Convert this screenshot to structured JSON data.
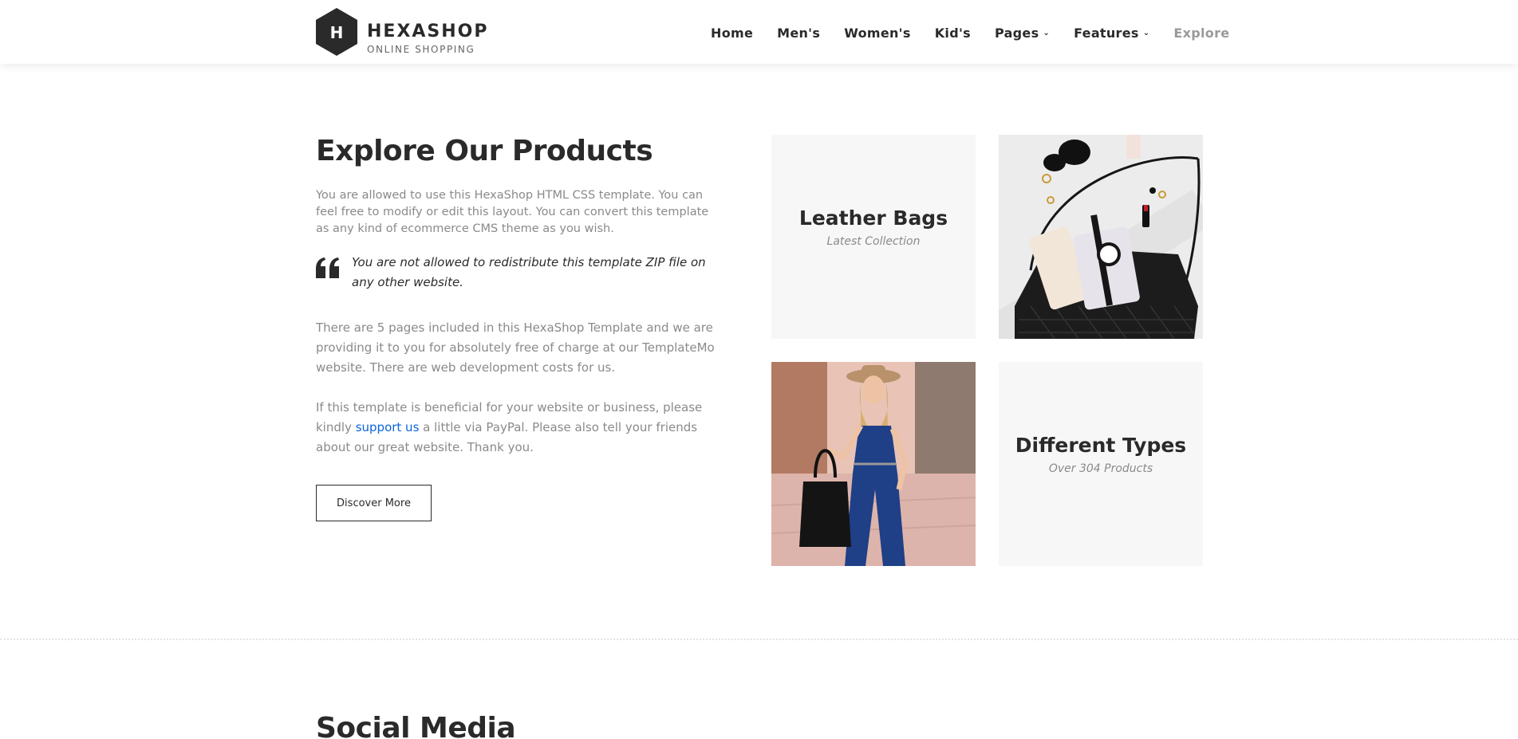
{
  "header": {
    "logo": {
      "letter": "H",
      "name": "HEXASHOP",
      "tagline": "ONLINE SHOPPING"
    },
    "nav": [
      {
        "label": "Home",
        "icon": ""
      },
      {
        "label": "Men's",
        "icon": ""
      },
      {
        "label": "Women's",
        "icon": ""
      },
      {
        "label": "Kid's",
        "icon": ""
      },
      {
        "label": "Pages",
        "icon": "chevron-down-icon"
      },
      {
        "label": "Features",
        "icon": "chevron-down-icon"
      },
      {
        "label": "Explore",
        "icon": ""
      }
    ]
  },
  "explore": {
    "title": "Explore Our Products",
    "para1": "You are allowed to use this HexaShop HTML CSS template. You can feel free to modify or edit this layout. You can convert this template as any kind of ecommerce CMS theme as you wish.",
    "quote": "You are not allowed to redistribute this template ZIP file on any other website.",
    "para2": "There are 5 pages included in this HexaShop Template and we are providing it to you for absolutely free of charge at our TemplateMo website. There are web development costs for us.",
    "para3_before": "If this template is beneficial for your website or business, please kindly ",
    "para3_link": "support us",
    "para3_after": " a little via PayPal. Please also tell your friends about our great website. Thank you.",
    "button_label": "Discover More"
  },
  "tiles": {
    "leather": {
      "title": "Leather Bags",
      "subtitle": "Latest Collection"
    },
    "types": {
      "title": "Different Types",
      "subtitle": "Over 304 Products"
    }
  },
  "social": {
    "title": "Social Media"
  },
  "colors": {
    "text": "#2a2a2a",
    "muted": "#8a8a8a",
    "link": "#0a64d8",
    "tile_bg": "#f7f7f7"
  }
}
